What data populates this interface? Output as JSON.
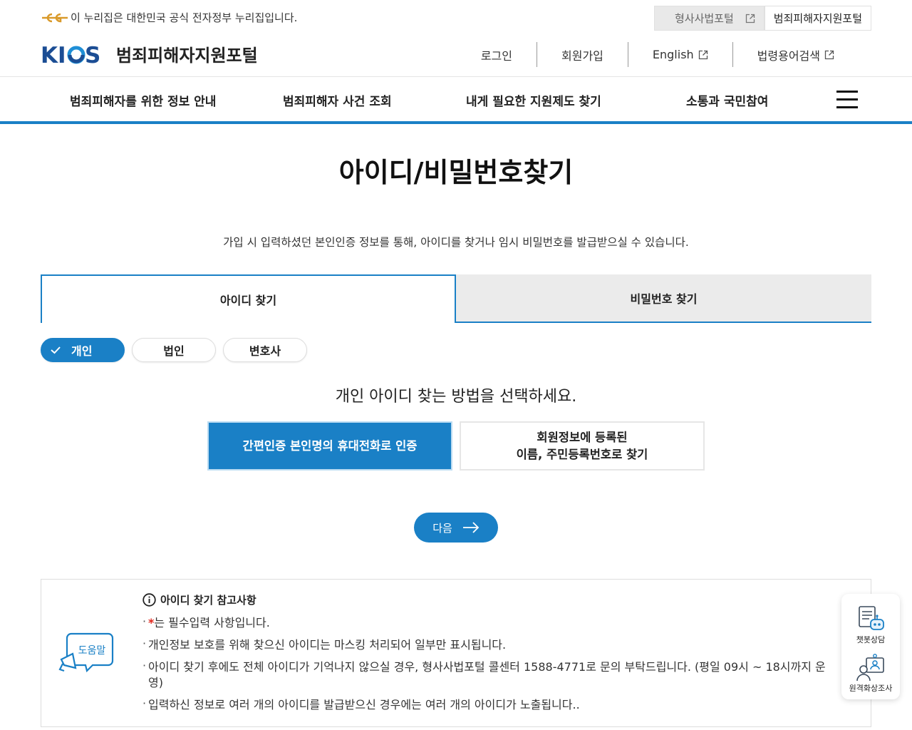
{
  "gov_bar": {
    "notice": "이 누리집은 대한민국 공식 전자정부 누리집입니다.",
    "portal_tabs": [
      "형사사법포털",
      "범죄피해자지원포털"
    ]
  },
  "header": {
    "logo_mark": "KICS",
    "site_name": "범죄피해자지원포털",
    "util_menu": [
      "로그인",
      "회원가입",
      "English",
      "법령용어검색"
    ]
  },
  "gnb": {
    "items": [
      "범죄피해자를 위한 정보 안내",
      "범죄피해자 사건 조회",
      "내게 필요한 지원제도 찾기",
      "소통과 국민참여"
    ]
  },
  "main": {
    "title": "아이디/비밀번호찾기",
    "description": "가입 시 입력하셨던 본인인증 정보를 통해, 아이디를 찾거나 임시 비밀번호를 발급받으실 수 있습니다.",
    "tabs": [
      "아이디 찾기",
      "비밀번호 찾기"
    ],
    "member_types": [
      "개인",
      "법인",
      "변호사"
    ],
    "method_title": "개인 아이디 찾는 방법을 선택하세요.",
    "method_a": "간편인증 본인명의 휴대전화로 인증",
    "method_b_line1": "회원정보에 등록된",
    "method_b_line2": "이름, 주민등록번호로 찾기",
    "next_label": "다음"
  },
  "help": {
    "icon_label": "도움말",
    "title": "아이디 찾기 참고사항",
    "req_mark": "*",
    "item1_rest": "는 필수입력 사항입니다.",
    "item2": "개인정보 보호를 위해 찾으신 아이디는 마스킹 처리되어 일부만 표시됩니다.",
    "item3": "아이디 찾기 후에도 전체 아이디가 기억나지 않으실 경우, 형사사법포털 콜센터 1588-4771로 문의 부탁드립니다. (평일 09시 ~ 18시까지 운영)",
    "item4": "입력하신 정보로 여러 개의 아이디를 발급받으신 경우에는 여러 개의 아이디가 노출됩니다.."
  },
  "floating": {
    "chatbot": "챗봇상담",
    "video": "원격화상조사"
  },
  "colors": {
    "primary": "#1a80c6",
    "logo_navy": "#1b4d94",
    "required": "#e0251b"
  }
}
